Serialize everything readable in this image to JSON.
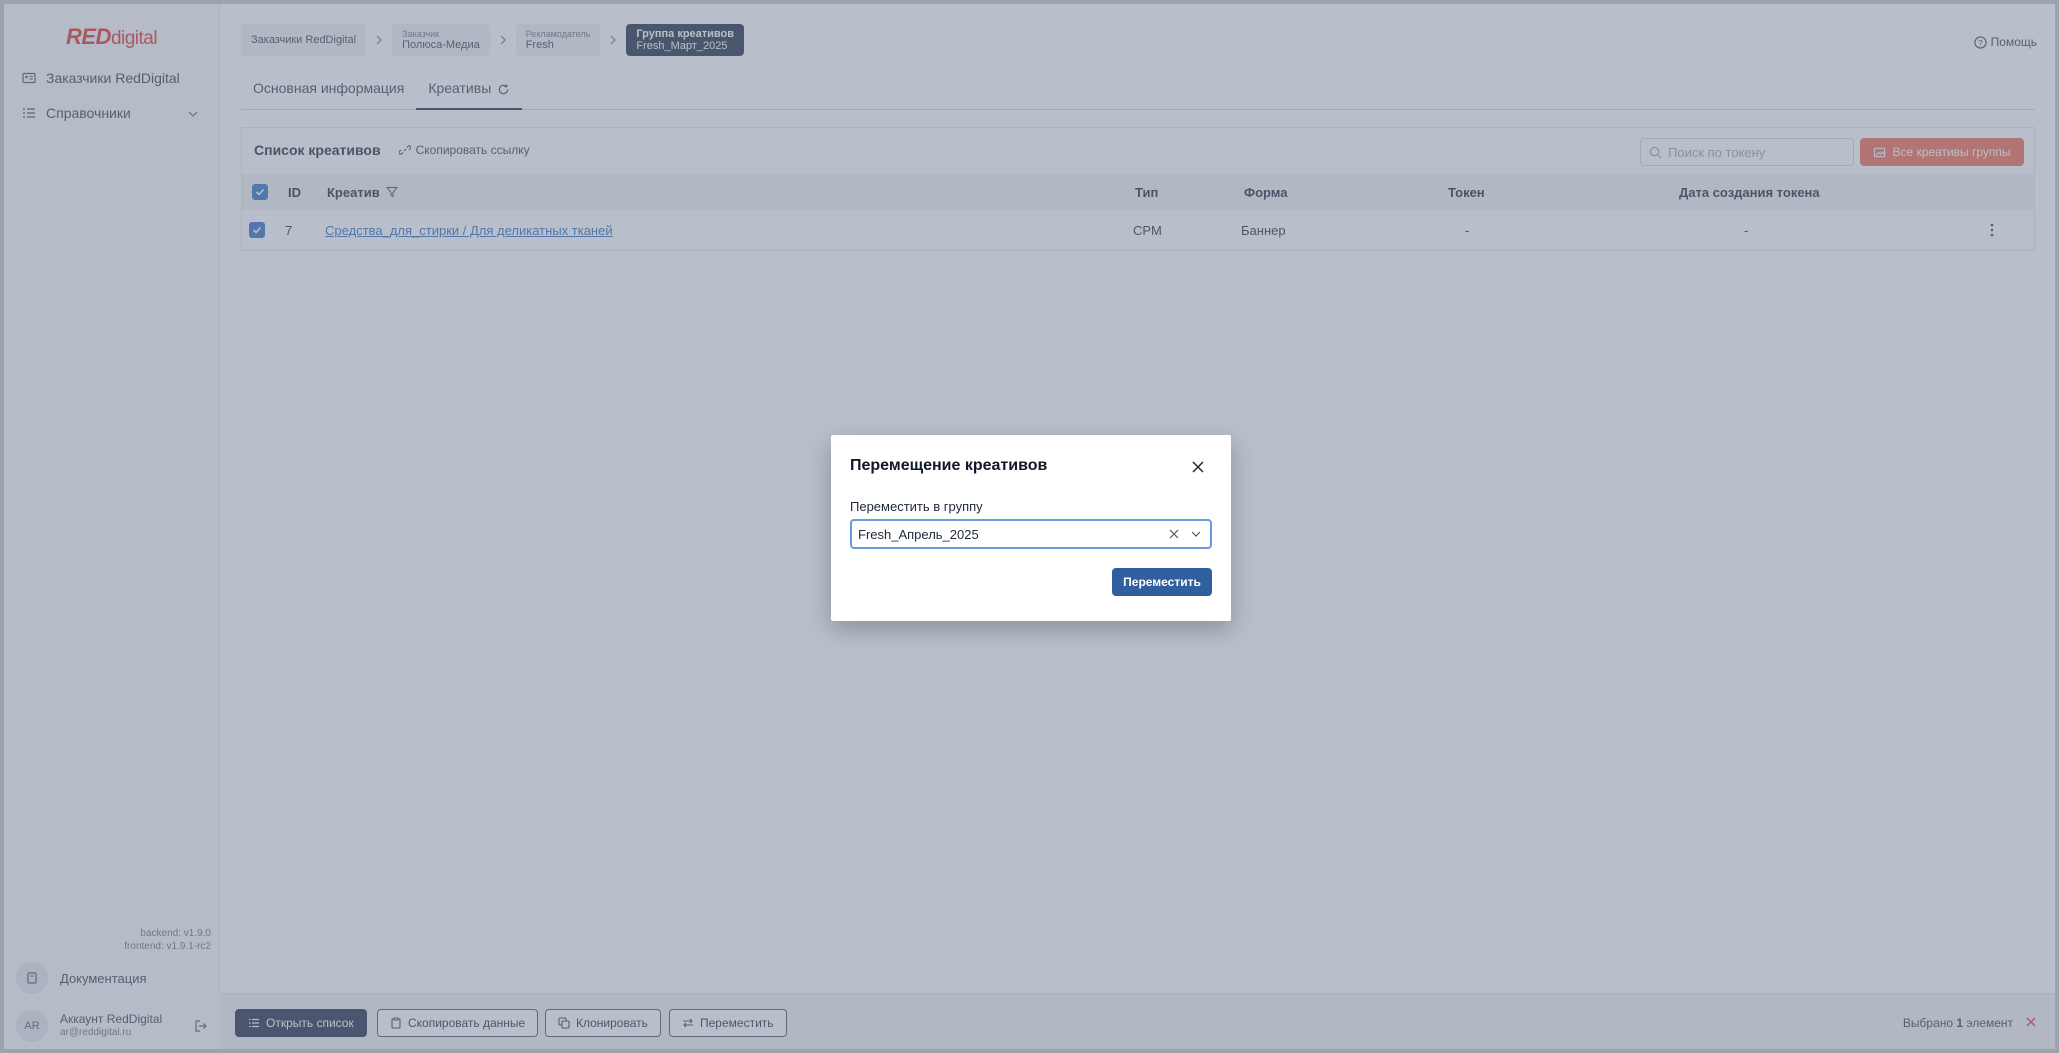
{
  "sidebar": {
    "logo_red": "RED",
    "logo_digital": "digital",
    "items": [
      {
        "label": "Заказчики RedDigital",
        "icon": "id-card-icon"
      },
      {
        "label": "Справочники",
        "icon": "list-icon"
      }
    ],
    "backend_version": "backend: v1.9.0",
    "frontend_version": "frontend: v1.9.1-rc2",
    "docs_label": "Документация",
    "account": {
      "initials": "AR",
      "name": "Аккаунт RedDigital",
      "email": "ar@reddigital.ru"
    }
  },
  "breadcrumbs": [
    {
      "caption": "",
      "value": "Заказчики RedDigital"
    },
    {
      "caption": "Заказчик",
      "value": "Полюса-Медиа"
    },
    {
      "caption": "Рекламодатель",
      "value": "Fresh"
    },
    {
      "caption": "Группа креативов",
      "value": "Fresh_Март_2025"
    }
  ],
  "help_label": "Помощь",
  "tabs": [
    {
      "label": "Основная информация",
      "active": false
    },
    {
      "label": "Креативы",
      "active": true
    }
  ],
  "panel": {
    "title": "Список креативов",
    "copy_link": "Скопировать ссылку",
    "search_placeholder": "Поиск по токену",
    "all_button": "Все креативы группы"
  },
  "table": {
    "headers": {
      "id": "ID",
      "creative": "Креатив",
      "type": "Тип",
      "form": "Форма",
      "token": "Токен",
      "date": "Дата создания токена"
    },
    "rows": [
      {
        "id": "7",
        "creative": "Средства_для_стирки / Для деликатных тканей",
        "type": "CPM",
        "form": "Баннер",
        "token": "-",
        "date": "-"
      }
    ]
  },
  "bottom_bar": {
    "open_list": "Открыть список",
    "copy_data": "Скопировать данные",
    "clone": "Клонировать",
    "move": "Переместить",
    "selected_prefix": "Выбрано ",
    "selected_count": "1",
    "selected_suffix": " элемент"
  },
  "modal": {
    "title": "Перемещение креативов",
    "field_label": "Переместить в группу",
    "selected_value": "Fresh_Апрель_2025",
    "submit": "Переместить"
  },
  "colors": {
    "accent": "#2f5f9e",
    "brand_red": "#e0322b",
    "dark": "#1f2d45"
  }
}
